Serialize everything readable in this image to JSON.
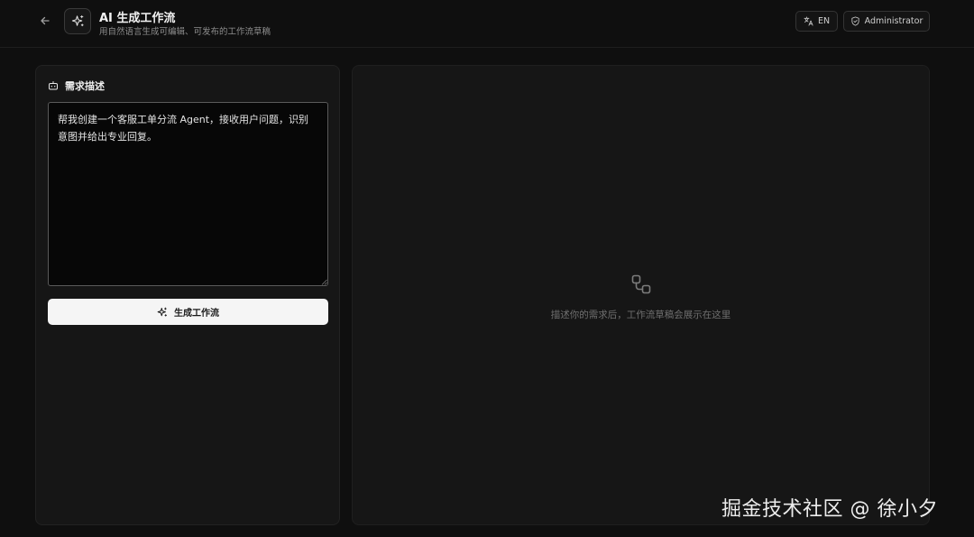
{
  "header": {
    "title": "AI 生成工作流",
    "subtitle": "用自然语言生成可编辑、可发布的工作流草稿",
    "lang_label": "EN",
    "user_label": "Administrator"
  },
  "left_panel": {
    "title": "需求描述",
    "textarea_value": "帮我创建一个客服工单分流 Agent，接收用户问题，识别意图并给出专业回复。",
    "generate_label": "生成工作流"
  },
  "right_panel": {
    "empty_text": "描述你的需求后，工作流草稿会展示在这里"
  },
  "watermark": {
    "text": "掘金技术社区 @ 徐小夕"
  },
  "icons": {
    "back": "arrow-left-icon",
    "app": "sparkles-icon",
    "lang": "translate-icon",
    "user": "shield-icon",
    "panel": "bot-icon",
    "generate": "sparkles-icon",
    "empty": "workflow-icon"
  },
  "colors": {
    "background": "#0f0f0f",
    "panel": "#161616",
    "primary_button": "#f5f5f5"
  }
}
